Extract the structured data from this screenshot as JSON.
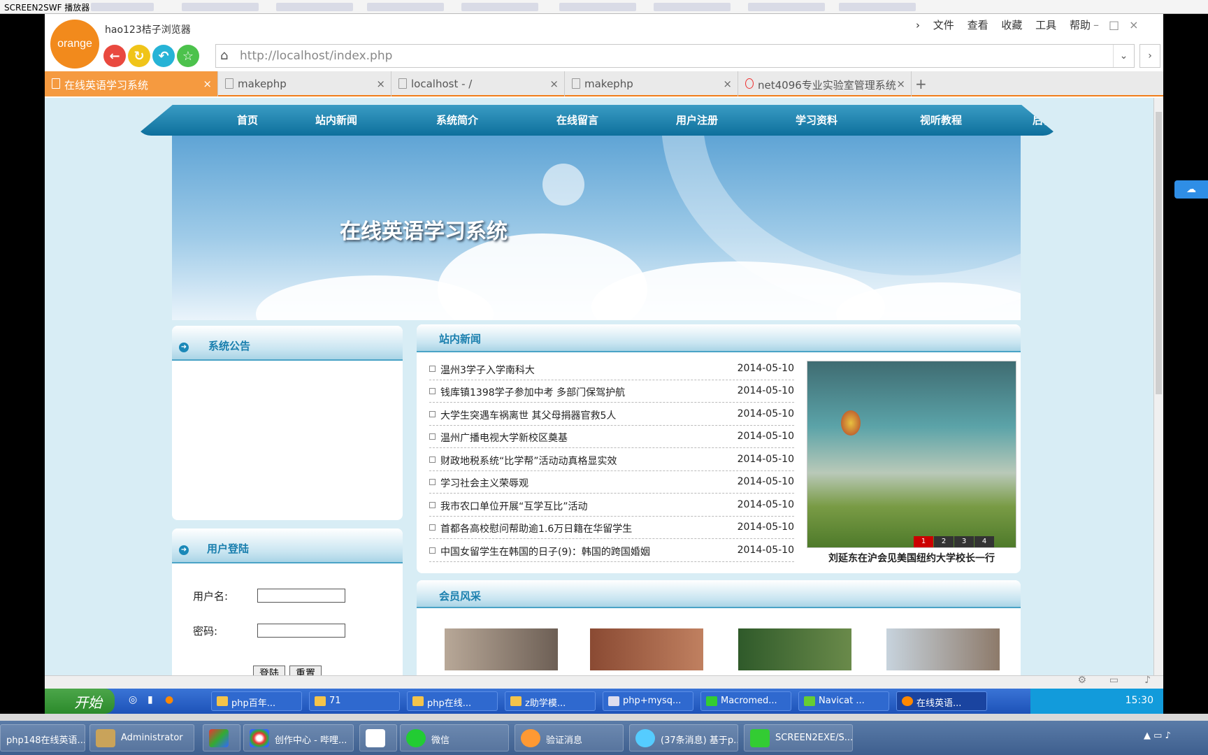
{
  "player": {
    "title": "SCREEN2SWF 播放器"
  },
  "browser": {
    "logo_text": "orange",
    "brand": "hao123桔子浏览器",
    "menu": [
      "文件",
      "查看",
      "收藏",
      "工具",
      "帮助"
    ],
    "url": "http://localhost/index.php",
    "tabs": [
      {
        "label": "在线英语学习系统",
        "active": true
      },
      {
        "label": "makephp"
      },
      {
        "label": "localhost - /"
      },
      {
        "label": "makephp"
      },
      {
        "label": "net4096专业实验室管理系统"
      }
    ]
  },
  "site": {
    "nav": [
      "首页",
      "站内新闻",
      "系统简介",
      "在线留言",
      "用户注册",
      "学习资料",
      "视听教程",
      "后台"
    ],
    "banner_title": "在线英语学习系统",
    "announcement_title": "系统公告",
    "login": {
      "title": "用户登陆",
      "username_label": "用户名:",
      "password_label": "密码:",
      "login_button": "登陆",
      "reset_button": "重置"
    },
    "news_title": "站内新闻",
    "news": [
      {
        "title": "温州3学子入学南科大",
        "date": "2014-05-10"
      },
      {
        "title": "钱库镇1398学子参加中考 多部门保驾护航",
        "date": "2014-05-10"
      },
      {
        "title": "大学生突遇车祸离世 其父母捐器官救5人",
        "date": "2014-05-10"
      },
      {
        "title": "温州广播电视大学新校区奠基",
        "date": "2014-05-10"
      },
      {
        "title": "财政地税系统“比学帮”活动动真格显实效",
        "date": "2014-05-10"
      },
      {
        "title": "学习社会主义荣辱观",
        "date": "2014-05-10"
      },
      {
        "title": "我市农口单位开展“互学互比”活动",
        "date": "2014-05-10"
      },
      {
        "title": "首都各高校慰问帮助逾1.6万日籍在华留学生",
        "date": "2014-05-10"
      },
      {
        "title": "中国女留学生在韩国的日子(9)：韩国的跨国婚姻",
        "date": "2014-05-10"
      }
    ],
    "slide": {
      "pages": [
        "1",
        "2",
        "3",
        "4"
      ],
      "current_page": 1,
      "caption": "刘延东在沪会见美国纽约大学校长一行"
    },
    "members_title": "会员风采"
  },
  "taskbar1": {
    "start": "开始",
    "items": [
      "php百年...",
      "71",
      "php在线...",
      "z助学模...",
      "php+mysq...",
      "Macromed...",
      "Navicat ...",
      "在线英语..."
    ],
    "clock": "15:30"
  },
  "taskbar2": {
    "items": [
      "php148在线英语...",
      "Administrator",
      "创作中心 - 哔哩...",
      "微信",
      "验证消息",
      "(37条消息) 基于p...",
      "SCREEN2EXE/S..."
    ]
  },
  "colors": {
    "accent": "#f07d1a",
    "nav": "#1a7fae",
    "page_bg": "#d8edf5"
  }
}
